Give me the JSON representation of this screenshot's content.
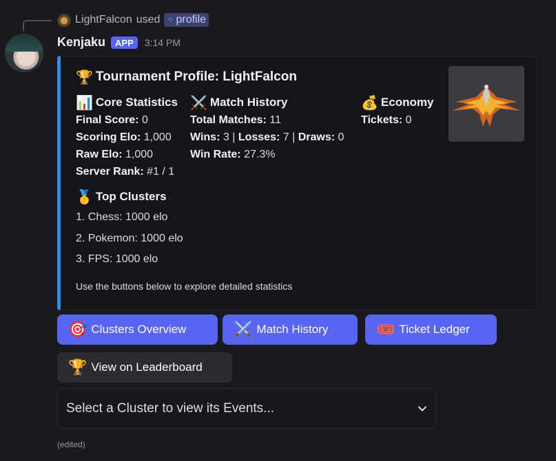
{
  "reply": {
    "user": "LightFalcon",
    "used_text": "used",
    "command": "profile",
    "command_icon": "grid-dots-icon"
  },
  "message": {
    "username": "Kenjaku",
    "badge": "APP",
    "timestamp": "3:14 PM",
    "edited": "(edited)"
  },
  "embed": {
    "accent_color": "#2f8de4",
    "title_icon": "🏆",
    "title": "Tournament Profile: LightFalcon",
    "core": {
      "icon": "📊",
      "name": "Core Statistics",
      "final_score_label": "Final Score:",
      "final_score": "0",
      "scoring_elo_label": "Scoring Elo:",
      "scoring_elo": "1,000",
      "raw_elo_label": "Raw Elo:",
      "raw_elo": "1,000",
      "server_rank_label": "Server Rank:",
      "server_rank": "#1 / 1"
    },
    "match": {
      "icon": "⚔️",
      "name": "Match History",
      "total_label": "Total Matches:",
      "total": "11",
      "wins_label": "Wins:",
      "wins": "3",
      "sep1": "|",
      "losses_label": "Losses:",
      "losses": "7",
      "sep2": "|",
      "draws_label": "Draws:",
      "draws": "0",
      "winrate_label": "Win Rate:",
      "winrate": "27.3%"
    },
    "economy": {
      "icon": "💰",
      "name": "Economy",
      "tickets_label": "Tickets:",
      "tickets": "0"
    },
    "clusters": {
      "icon": "🥇",
      "name": "Top Clusters",
      "items": [
        "1. Chess: 1000 elo",
        "2. Pokemon: 1000 elo",
        "3. FPS: 1000 elo"
      ]
    },
    "footer": "Use the buttons below to explore detailed statistics"
  },
  "buttons": {
    "clusters": {
      "icon": "🎯",
      "label": "Clusters Overview"
    },
    "match_history": {
      "icon": "⚔️",
      "label": "Match History"
    },
    "ticket_ledger": {
      "icon": "🎟️",
      "label": "Ticket Ledger"
    },
    "leaderboard": {
      "icon": "🏆",
      "label": "View on Leaderboard"
    }
  },
  "select": {
    "placeholder": "Select a Cluster to view its Events..."
  },
  "colors": {
    "brand": "#5865f2",
    "background": "#1a1a1e"
  }
}
